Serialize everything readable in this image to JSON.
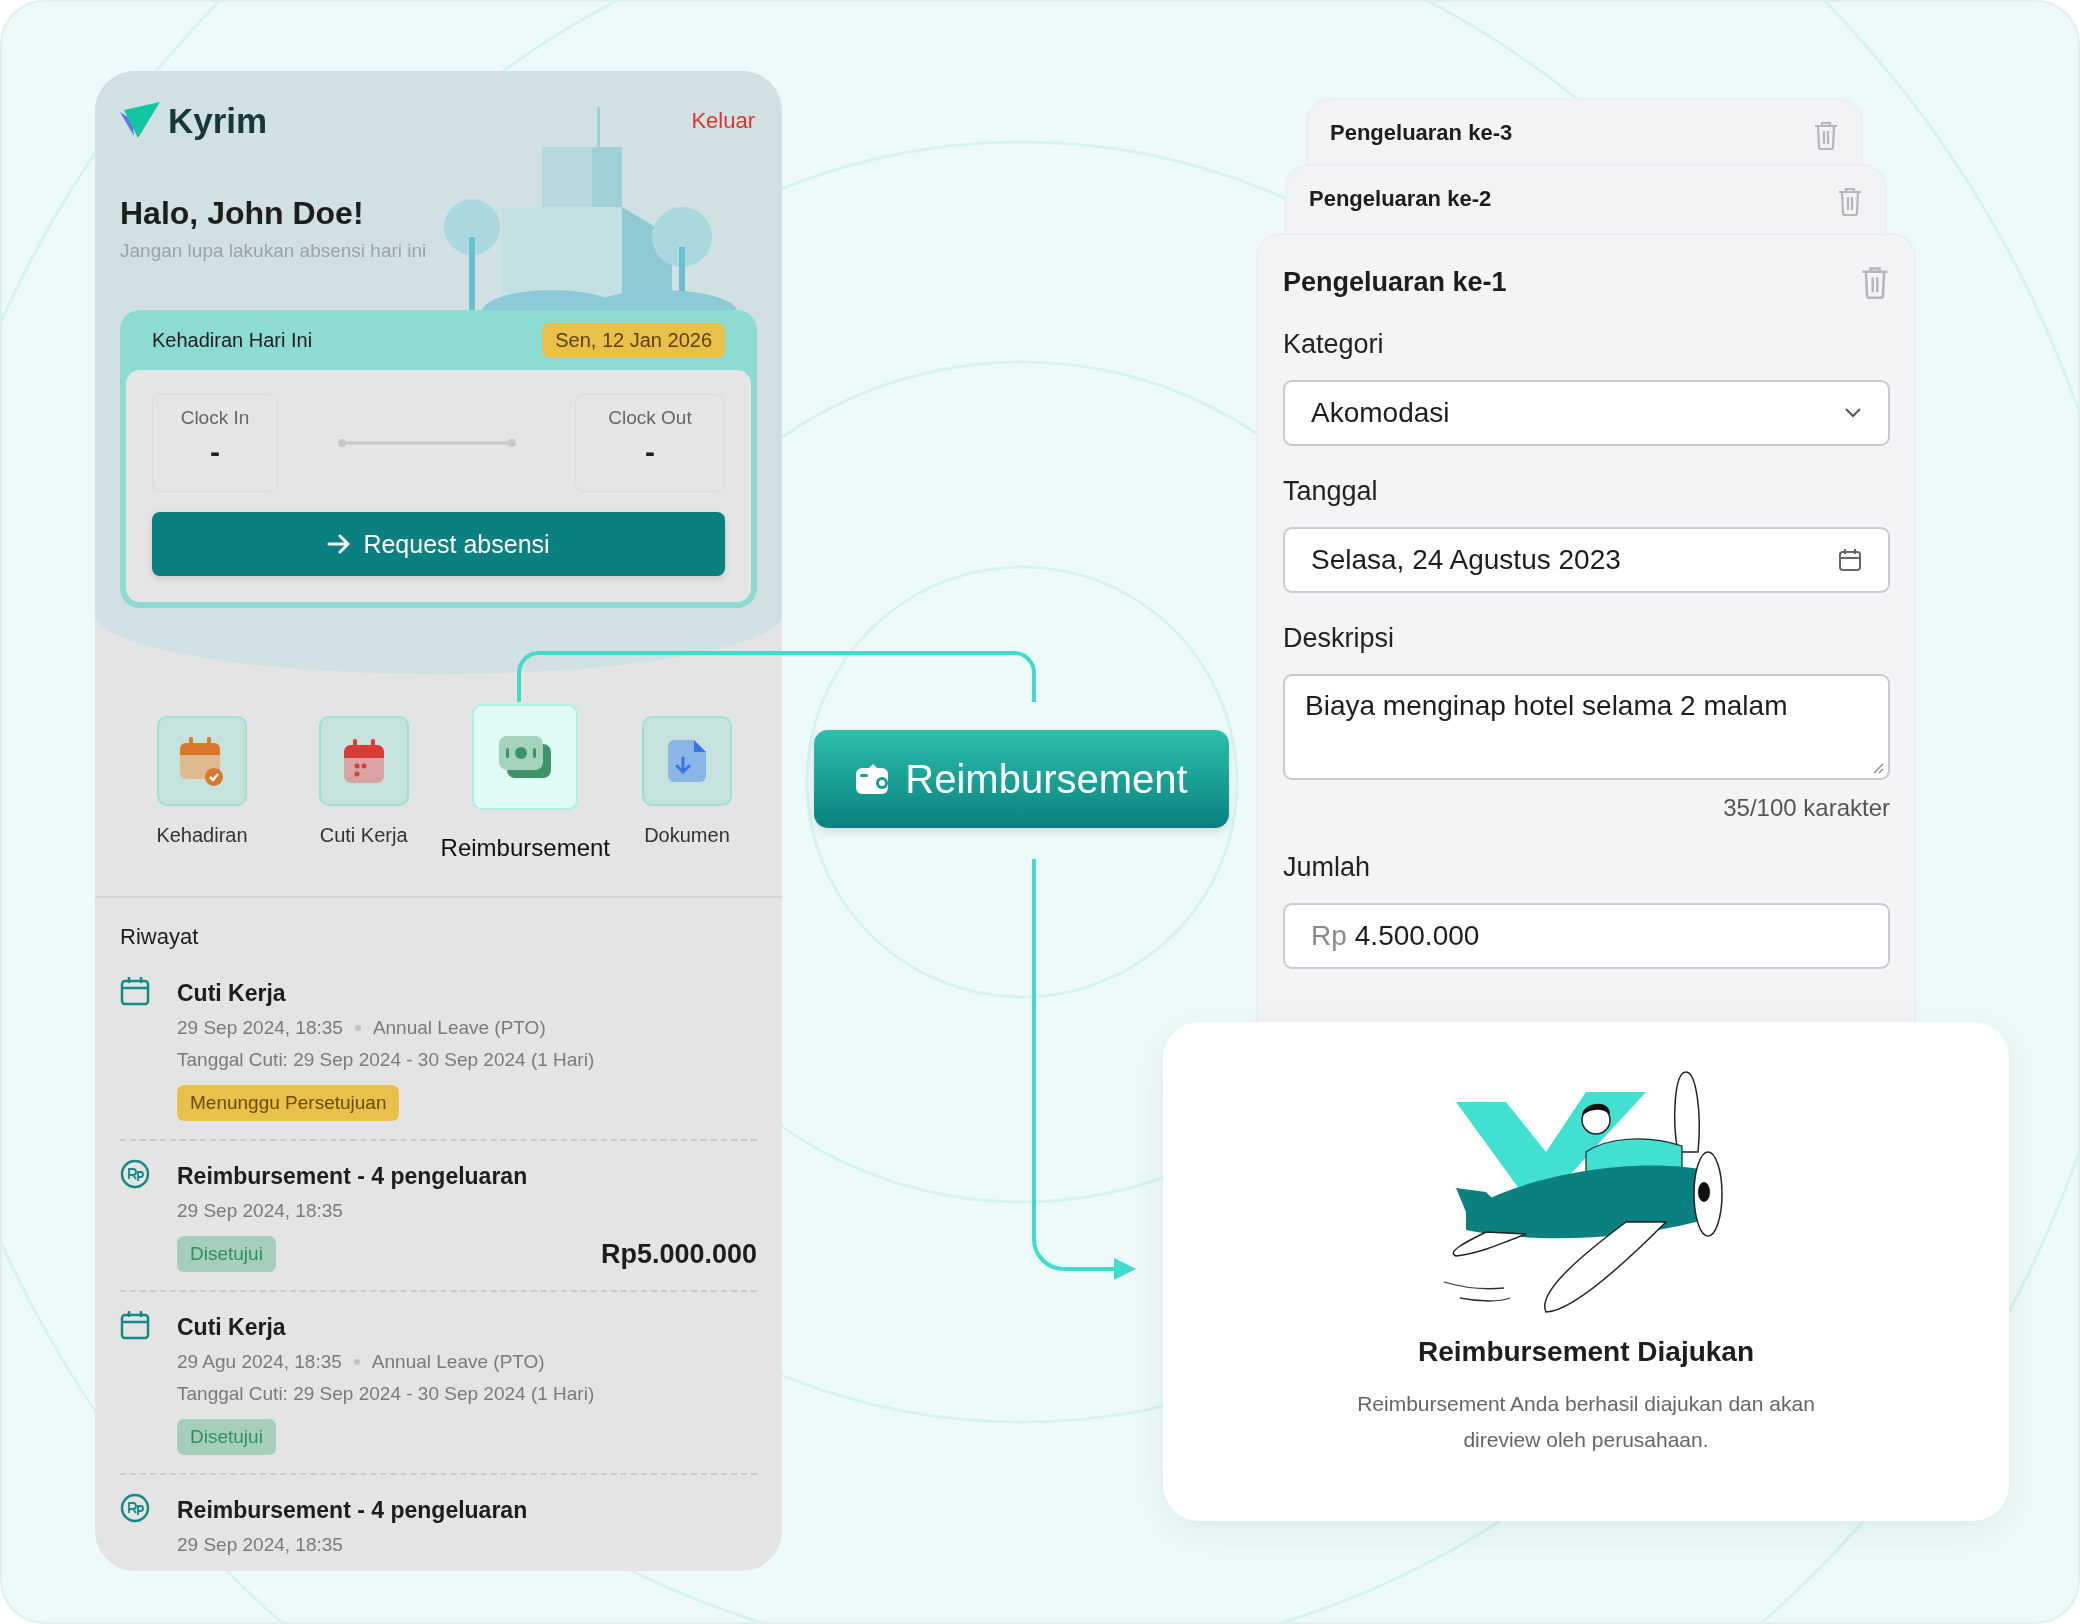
{
  "phone": {
    "logo": "Kyrim",
    "logout": "Keluar",
    "greeting": "Halo, John Doe!",
    "subtitle": "Jangan lupa lakukan absensi hari ini",
    "attendance": {
      "title": "Kehadiran Hari Ini",
      "date": "Sen, 12 Jan 2026",
      "clock_in": {
        "label": "Clock In",
        "value": "-"
      },
      "clock_out": {
        "label": "Clock Out",
        "value": "-"
      },
      "button": "Request absensi"
    },
    "menu": [
      {
        "label": "Kehadiran",
        "kind": "attendance",
        "selected": false
      },
      {
        "label": "Cuti Kerja",
        "kind": "leave",
        "selected": false
      },
      {
        "label": "Reimbursement",
        "kind": "reimbursement",
        "selected": true
      },
      {
        "label": "Dokumen",
        "kind": "document",
        "selected": false
      }
    ],
    "history_title": "Riwayat",
    "history": [
      {
        "kind": "leave",
        "title": "Cuti Kerja",
        "time": "29 Sep 2024, 18:35",
        "type": "Annual Leave (PTO)",
        "period": "Tanggal Cuti: 29 Sep 2024 - 30 Sep 2024 (1 Hari)",
        "status": {
          "label": "Menunggu Persetujuan",
          "kind": "pending"
        }
      },
      {
        "kind": "reimbursement",
        "title": "Reimbursement - 4 pengeluaran",
        "time": "29 Sep 2024, 18:35",
        "status": {
          "label": "Disetujui",
          "kind": "approved"
        },
        "amount": "Rp5.000.000"
      },
      {
        "kind": "leave",
        "title": "Cuti Kerja",
        "time": "29 Agu 2024, 18:35",
        "type": "Annual Leave (PTO)",
        "period": "Tanggal Cuti: 29 Sep 2024 - 30 Sep 2024 (1 Hari)",
        "status": {
          "label": "Disetujui",
          "kind": "approved"
        }
      },
      {
        "kind": "reimbursement",
        "title": "Reimbursement - 4 pengeluaran",
        "time": "29 Sep 2024, 18:35"
      }
    ]
  },
  "feature_button": {
    "label": "Reimbursement"
  },
  "expense_form": {
    "stacked_cards": [
      {
        "title": "Pengeluaran ke-3"
      },
      {
        "title": "Pengeluaran ke-2"
      }
    ],
    "title": "Pengeluaran ke-1",
    "fields": [
      {
        "kind": "select",
        "label": "Kategori",
        "value": "Akomodasi"
      },
      {
        "kind": "date",
        "label": "Tanggal",
        "value": "Selasa, 24 Agustus 2023"
      },
      {
        "kind": "textarea",
        "label": "Deskripsi",
        "value": "Biaya menginap hotel selama 2 malam",
        "counter": "35/100 karakter"
      },
      {
        "kind": "amount",
        "label": "Jumlah",
        "prefix": "Rp",
        "value": "4.500.000"
      }
    ]
  },
  "success_card": {
    "title": "Reimbursement Diajukan",
    "message": "Reimbursement Anda berhasil diajukan dan akan direview oleh perusahaan."
  }
}
